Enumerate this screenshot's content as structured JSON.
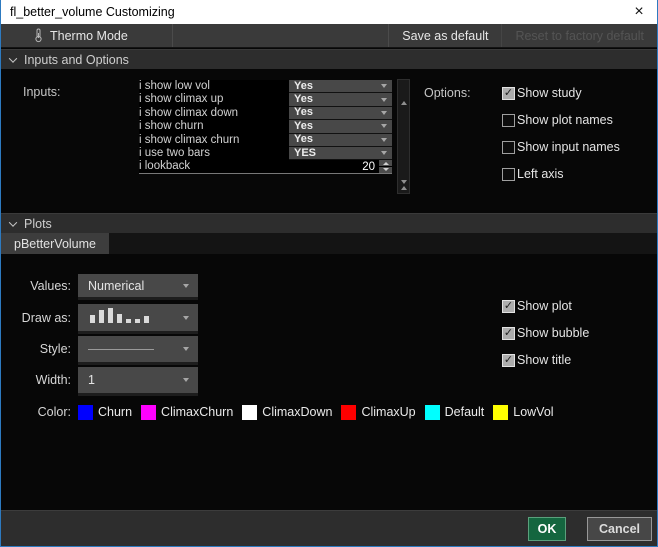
{
  "window": {
    "title": "fl_better_volume Customizing",
    "close_glyph": "×"
  },
  "toolbar": {
    "thermo_mode_label": "Thermo Mode",
    "save_default_label": "Save as default",
    "reset_default_label": "Reset to factory default"
  },
  "sections": {
    "inputs_header": "Inputs and Options",
    "plots_header": "Plots"
  },
  "inputs": {
    "label": "Inputs:",
    "rows": [
      {
        "name": "i show low vol",
        "value": "Yes"
      },
      {
        "name": "i show climax up",
        "value": "Yes"
      },
      {
        "name": "i show climax down",
        "value": "Yes"
      },
      {
        "name": "i show churn",
        "value": "Yes"
      },
      {
        "name": "i show climax churn",
        "value": "Yes"
      },
      {
        "name": "i use two bars",
        "value": "YES"
      },
      {
        "name": "i lookback",
        "value": "20"
      }
    ]
  },
  "options": {
    "label": "Options:",
    "checkboxes": [
      {
        "label": "Show study",
        "checked": true
      },
      {
        "label": "Show plot names",
        "checked": false
      },
      {
        "label": "Show input names",
        "checked": false
      },
      {
        "label": "Left axis",
        "checked": false
      }
    ]
  },
  "plots": {
    "tab_label": "pBetterVolume",
    "values_label": "Values:",
    "values_value": "Numerical",
    "draw_as_label": "Draw as:",
    "style_label": "Style:",
    "width_label": "Width:",
    "width_value": "1",
    "checkboxes": [
      {
        "label": "Show plot",
        "checked": true
      },
      {
        "label": "Show bubble",
        "checked": true
      },
      {
        "label": "Show title",
        "checked": true
      }
    ],
    "color_label": "Color:",
    "swatches": [
      {
        "name": "Churn",
        "color": "#0000ff"
      },
      {
        "name": "ClimaxChurn",
        "color": "#ff00ff"
      },
      {
        "name": "ClimaxDown",
        "color": "#ffffff"
      },
      {
        "name": "ClimaxUp",
        "color": "#ff0000"
      },
      {
        "name": "Default",
        "color": "#00ffff"
      },
      {
        "name": "LowVol",
        "color": "#ffff00"
      }
    ]
  },
  "footer": {
    "ok_label": "OK",
    "cancel_label": "Cancel"
  }
}
